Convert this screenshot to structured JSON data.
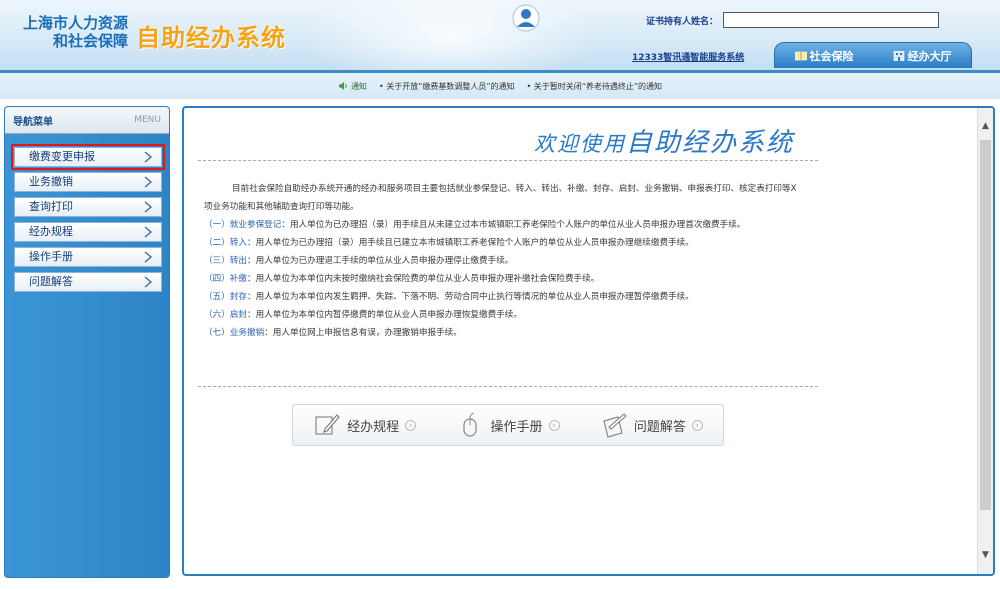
{
  "header": {
    "org_line1": "上海市人力资源",
    "org_line2": "和社会保障",
    "app_title": "自助经办系统",
    "cert_holder_label": "证书持有人姓名：",
    "cert_holder_value": "",
    "service_link": "12333智讯通智能服务系统",
    "tabs": [
      {
        "label": "社会保险",
        "icon": "book-icon"
      },
      {
        "label": "经办大厅",
        "icon": "building-icon"
      }
    ]
  },
  "notices": {
    "head": "通知",
    "items": [
      "• 关于开放“缴费基数调整人员”的通知",
      "• 关于暂时关闭“养老待遇终止”的通知"
    ]
  },
  "sidebar": {
    "title": "导航菜单",
    "title_en": "MENU",
    "items": [
      {
        "label": "缴费变更申报"
      },
      {
        "label": "业务撤销"
      },
      {
        "label": "查询打印"
      },
      {
        "label": "经办规程"
      },
      {
        "label": "操作手册"
      },
      {
        "label": "问题解答"
      }
    ]
  },
  "main": {
    "welcome_prefix": "欢迎使用",
    "welcome_main": "自助经办系统",
    "intro": "目前社会保险自助经办系统开通的经办和服务项目主要包括就业参保登记、转入、转出、补缴、封存、启封、业务撤销、申报表打印、核定表打印等X项业务功能和其他辅助查询打印等功能。",
    "items": [
      {
        "label": "（一）就业参保登记",
        "text": "：用人单位为已办理招（录）用手续且从未建立过本市城镇职工养老保险个人账户的单位从业人员申报办理首次缴费手续。"
      },
      {
        "label": "（二）转入",
        "text": "：用人单位为已办理招（录）用手续且已建立本市城镇职工养老保险个人账户的单位从业人员申报办理继续缴费手续。"
      },
      {
        "label": "（三）转出",
        "text": "：用人单位为已办理退工手续的单位从业人员申报办理停止缴费手续。"
      },
      {
        "label": "（四）补缴",
        "text": "：用人单位为本单位内未按时缴纳社会保险费的单位从业人员申报办理补缴社会保险费手续。"
      },
      {
        "label": "（五）封存",
        "text": "：用人单位为本单位内发生羁押、失踪、下落不明、劳动合同中止执行等情况的单位从业人员申报办理暂停缴费手续。"
      },
      {
        "label": "（六）启封",
        "text": "：用人单位为本单位内暂停缴费的单位从业人员申报办理恢复缴费手续。"
      },
      {
        "label": "（七）业务撤销",
        "text": "：用人单位网上申报信息有误，办理撤销申报手续。"
      }
    ],
    "shortcuts": [
      {
        "label": "经办规程",
        "icon": "pen-icon"
      },
      {
        "label": "操作手册",
        "icon": "mouse-icon"
      },
      {
        "label": "问题解答",
        "icon": "pencil-note-icon"
      }
    ]
  },
  "colors": {
    "brand_blue": "#2b7cc1",
    "title_orange": "#f6a318",
    "highlight_red": "#e8131b"
  }
}
